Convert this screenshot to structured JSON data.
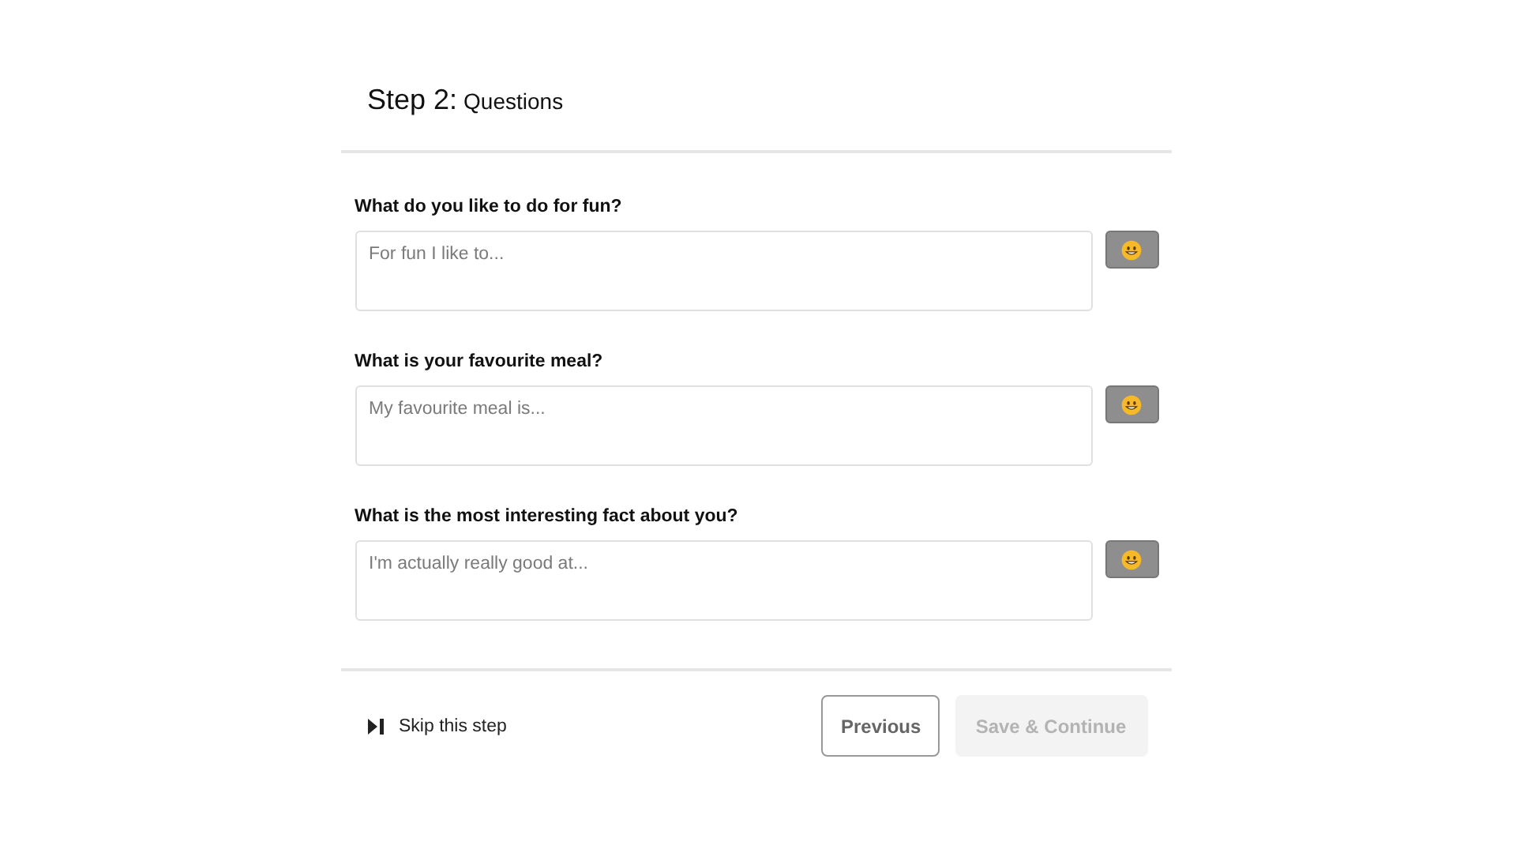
{
  "header": {
    "step": "Step 2:",
    "title": "Questions"
  },
  "questions": [
    {
      "label": "What do you like to do for fun?",
      "placeholder": "For fun I like to..."
    },
    {
      "label": "What is your favourite meal?",
      "placeholder": "My favourite meal is..."
    },
    {
      "label": "What is the most interesting fact about you?",
      "placeholder": "I'm actually really good at..."
    }
  ],
  "footer": {
    "skip": "Skip this step",
    "previous": {
      "label": "Previous",
      "disabled": false
    },
    "next": {
      "label": "Save & Continue",
      "disabled": true
    }
  }
}
